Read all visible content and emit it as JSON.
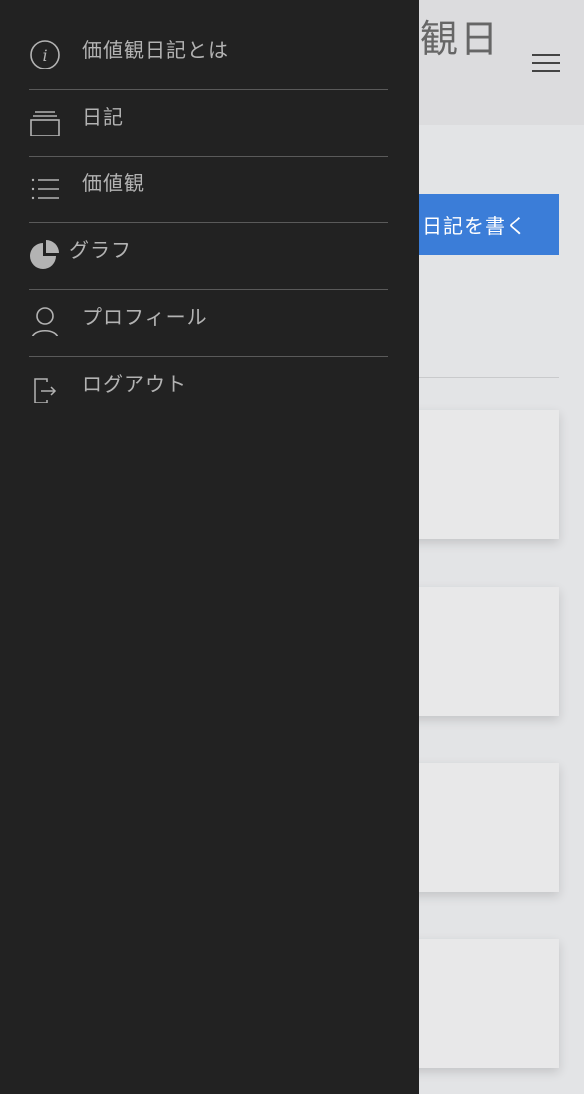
{
  "page": {
    "title_partial": "観日",
    "write_button_label": "日記を書く"
  },
  "drawer": {
    "items": [
      {
        "label": "価値観日記とは",
        "icon": "info-icon"
      },
      {
        "label": "日記",
        "icon": "folder-stack-icon"
      },
      {
        "label": "価値観",
        "icon": "list-icon"
      },
      {
        "label": "グラフ",
        "icon": "pie-chart-icon"
      },
      {
        "label": "プロフィール",
        "icon": "person-icon"
      },
      {
        "label": "ログアウト",
        "icon": "logout-icon"
      }
    ]
  }
}
